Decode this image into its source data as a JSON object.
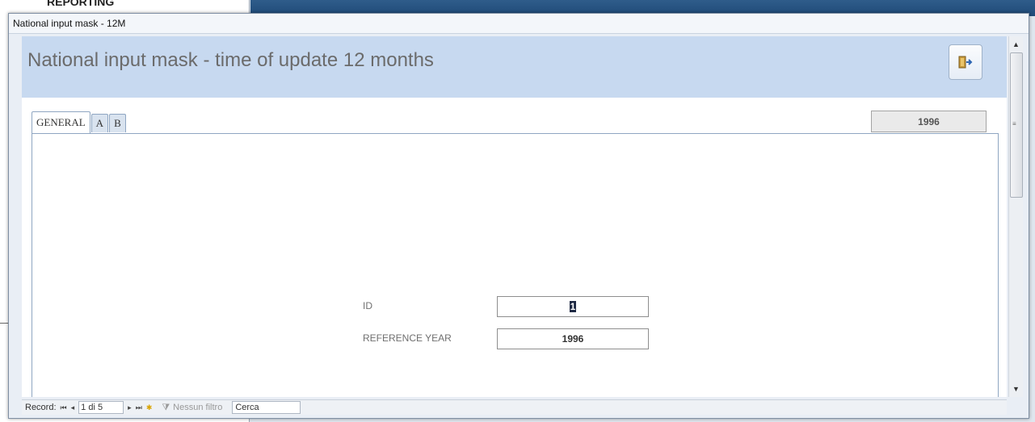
{
  "background": {
    "left_heading": "REPORTING"
  },
  "window": {
    "title": "National input mask - 12M"
  },
  "header": {
    "title": "National input mask - time of update 12 months",
    "exit_icon": "exit-door-icon"
  },
  "year_display": "1996",
  "tabs": [
    {
      "label": "GENERAL",
      "active": true
    },
    {
      "label": "A",
      "active": false
    },
    {
      "label": "B",
      "active": false
    }
  ],
  "form": {
    "id_label": "ID",
    "id_value": "1",
    "reference_year_label": "REFERENCE YEAR",
    "reference_year_value": "1996"
  },
  "navigation": {
    "record_label": "Record:",
    "record_position": "1 di 5",
    "filter_label": "Nessun filtro",
    "search_label": "Cerca"
  }
}
